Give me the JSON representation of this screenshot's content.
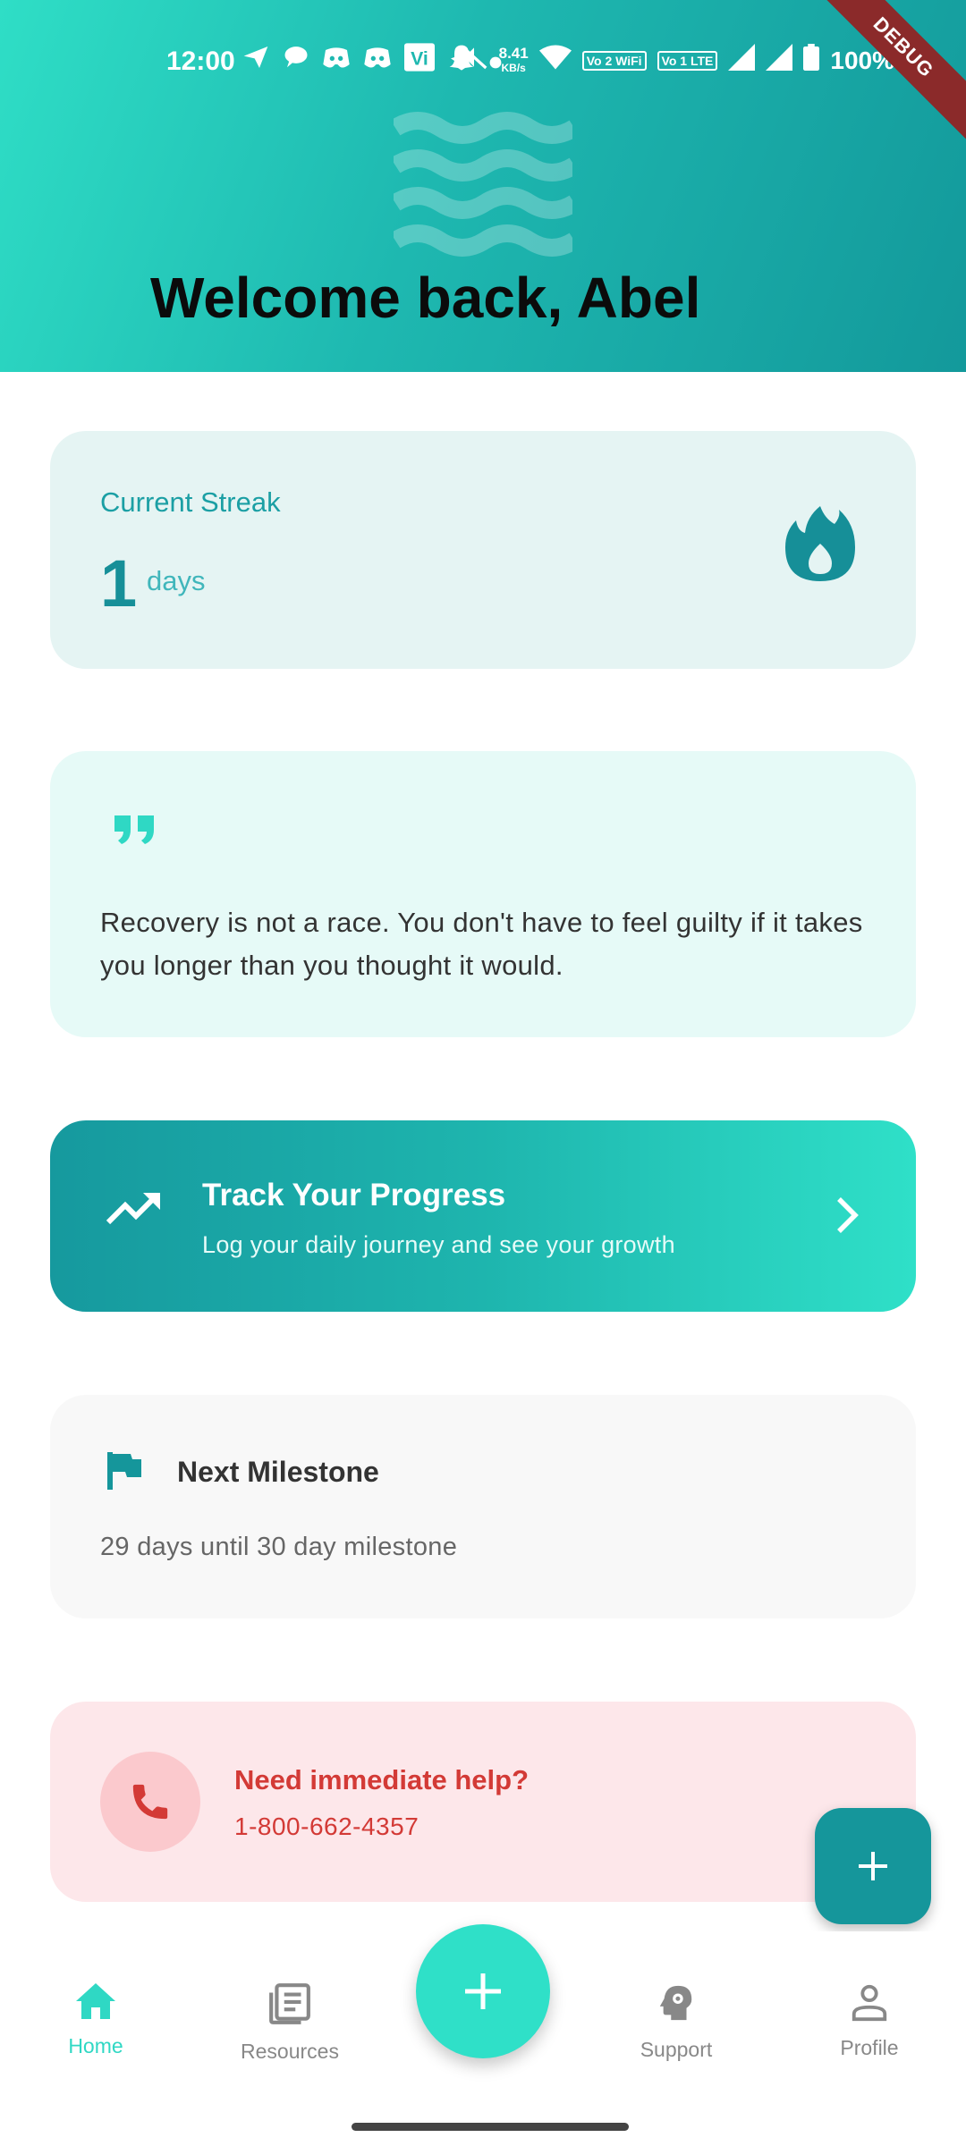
{
  "status_bar": {
    "time": "12:00",
    "net_speed_value": "8.41",
    "net_speed_unit": "KB/s",
    "sim1_label": "Vo 2 WiFi",
    "sim2_label": "Vo 1 LTE",
    "battery": "100%",
    "debug_label": "DEBUG"
  },
  "header": {
    "welcome": "Welcome back, Abel"
  },
  "streak": {
    "label": "Current Streak",
    "count": "1",
    "unit": "days",
    "icon": "fire-icon"
  },
  "quote": {
    "text": "Recovery is not a race. You don't have to feel guilty if it takes you longer than you thought it would.",
    "icon": "quote-icon"
  },
  "progress": {
    "title": "Track Your Progress",
    "subtitle": "Log your daily journey and see your growth"
  },
  "milestone": {
    "title": "Next Milestone",
    "text": "29 days until 30 day milestone"
  },
  "help": {
    "title": "Need immediate help?",
    "phone": "1-800-662-4357"
  },
  "nav": {
    "items": [
      {
        "label": "Home",
        "icon": "home-icon",
        "active": true
      },
      {
        "label": "Resources",
        "icon": "newspaper-icon",
        "active": false
      },
      {
        "label": "Support",
        "icon": "psychology-icon",
        "active": false
      },
      {
        "label": "Profile",
        "icon": "person-icon",
        "active": false
      }
    ]
  },
  "colors": {
    "accent": "#2fe0c8",
    "teal_dark": "#15969b",
    "danger": "#d33a36"
  }
}
